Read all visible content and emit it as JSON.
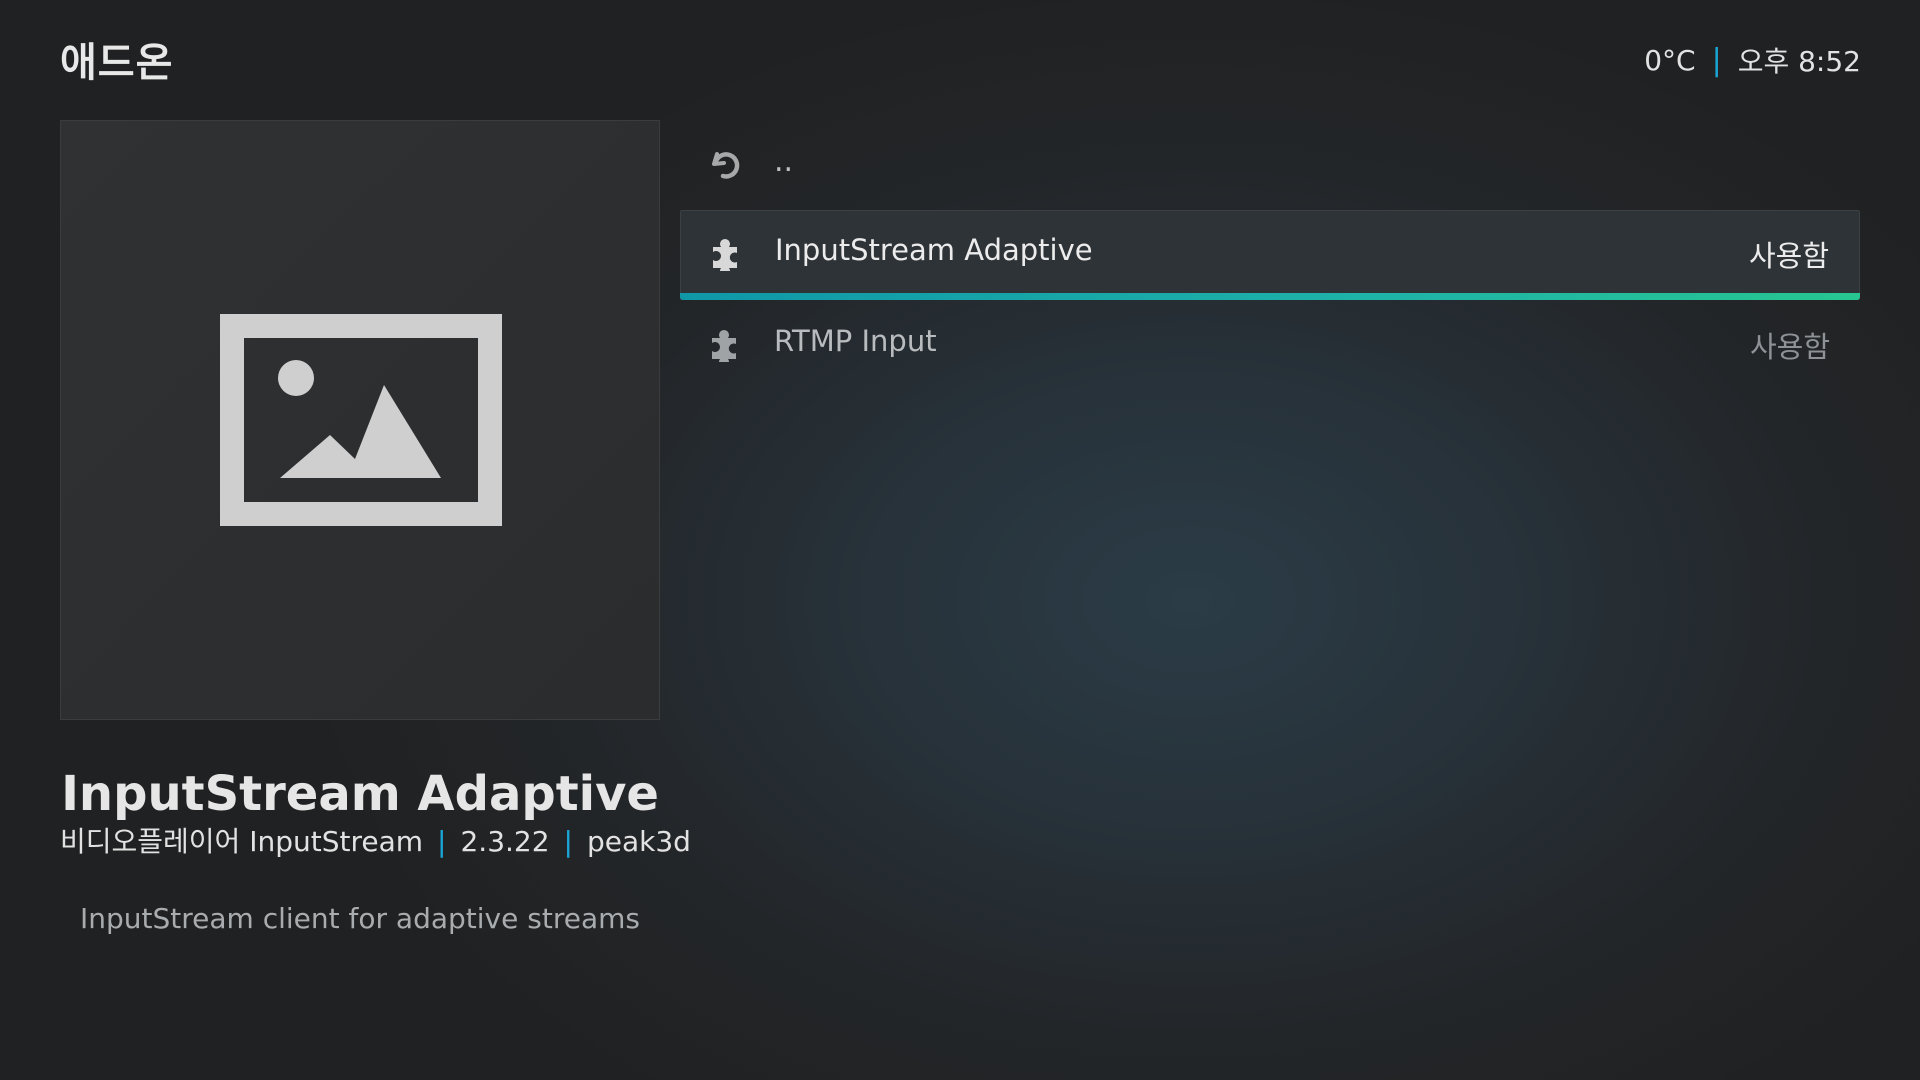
{
  "header": {
    "title": "애드온",
    "temperature": "0°C",
    "time": "오후 8:52"
  },
  "thumbnail": {
    "icon": "image-placeholder-icon"
  },
  "info": {
    "title": "InputStream Adaptive",
    "category": "비디오플레이어 InputStream",
    "version": "2.3.22",
    "author": "peak3d",
    "description": "InputStream client for adaptive streams"
  },
  "list": {
    "parent_label": "..",
    "parent_icon": "back-arrow-icon",
    "items": [
      {
        "label": "InputStream Adaptive",
        "status": "사용함",
        "icon": "puzzle-icon",
        "selected": true
      },
      {
        "label": "RTMP Input",
        "status": "사용함",
        "icon": "puzzle-icon",
        "selected": false
      }
    ]
  },
  "colors": {
    "accent": "#1aa7d8",
    "focus_start": "#0f97a8",
    "focus_end": "#27c690"
  }
}
